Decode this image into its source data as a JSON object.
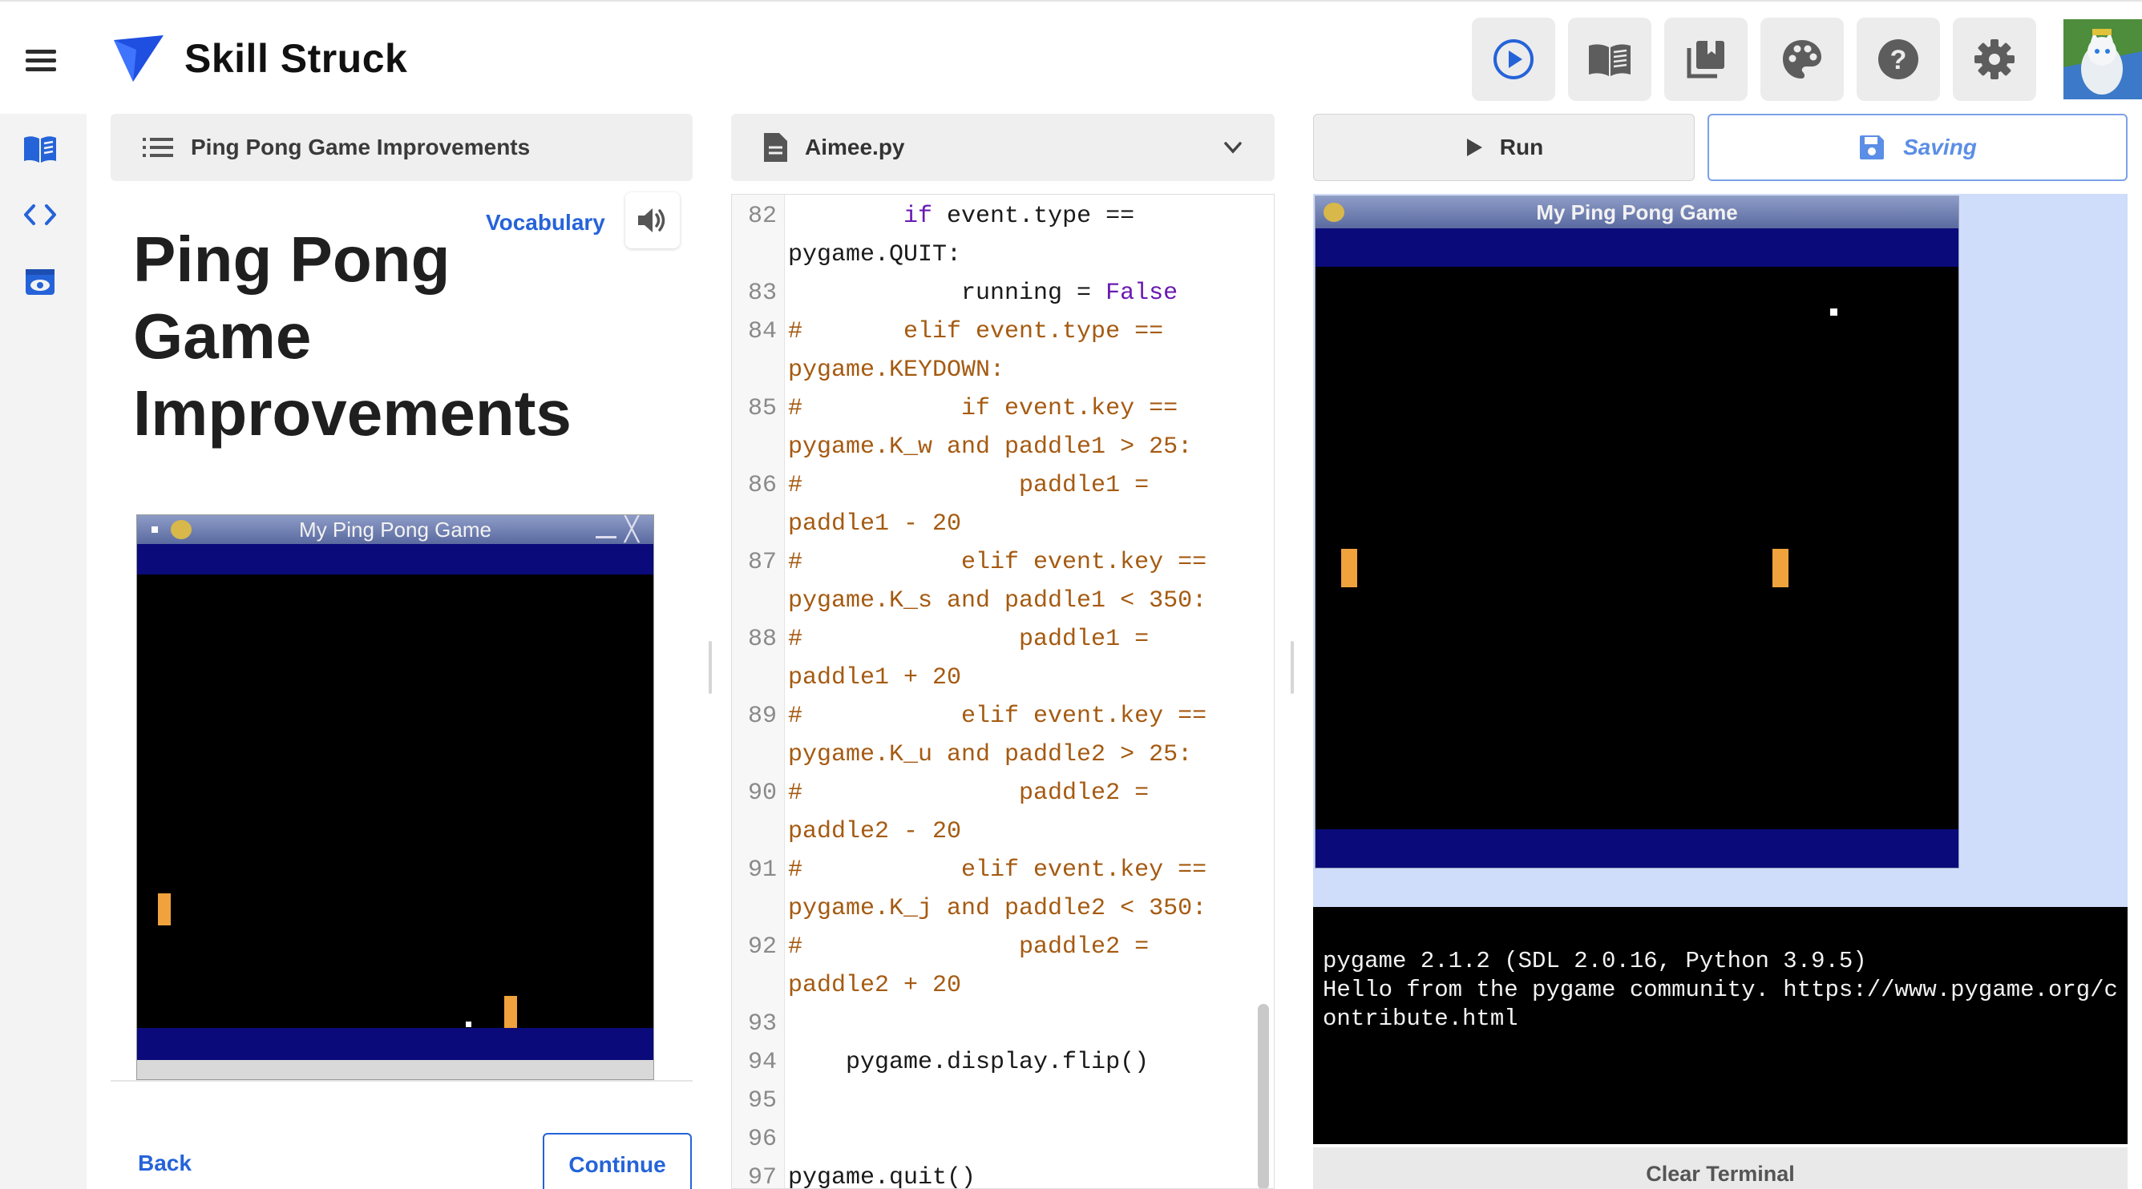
{
  "app": {
    "brand": "Skill Struck"
  },
  "toolbar": {
    "icons": [
      "run-preview-icon",
      "book-icon",
      "library-icon",
      "palette-icon",
      "help-icon",
      "settings-icon"
    ]
  },
  "left_rail": {
    "icons": [
      "lesson-book-icon",
      "code-brackets-icon",
      "preview-eye-icon"
    ]
  },
  "lesson": {
    "header_title": "Ping Pong Game Improvements",
    "title": "Ping Pong Game Improvements",
    "vocabulary_label": "Vocabulary",
    "game_window_title": "My Ping Pong Game",
    "back_label": "Back",
    "continue_label": "Continue"
  },
  "editor": {
    "file_name": "Aimee.py",
    "lines": [
      {
        "n": "82",
        "text": "        if event.type ==",
        "type": "code"
      },
      {
        "n": "",
        "text": "pygame.QUIT:",
        "type": "code"
      },
      {
        "n": "83",
        "text": "            running = False",
        "type": "code"
      },
      {
        "n": "84",
        "text": "#       elif event.type ==",
        "type": "comment"
      },
      {
        "n": "",
        "text": "pygame.KEYDOWN:",
        "type": "comment"
      },
      {
        "n": "85",
        "text": "#           if event.key ==",
        "type": "comment"
      },
      {
        "n": "",
        "text": "pygame.K_w and paddle1 > 25:",
        "type": "comment"
      },
      {
        "n": "86",
        "text": "#               paddle1 =",
        "type": "comment"
      },
      {
        "n": "",
        "text": "paddle1 - 20",
        "type": "comment"
      },
      {
        "n": "87",
        "text": "#           elif event.key ==",
        "type": "comment"
      },
      {
        "n": "",
        "text": "pygame.K_s and paddle1 < 350:",
        "type": "comment"
      },
      {
        "n": "88",
        "text": "#               paddle1 =",
        "type": "comment"
      },
      {
        "n": "",
        "text": "paddle1 + 20",
        "type": "comment"
      },
      {
        "n": "89",
        "text": "#           elif event.key ==",
        "type": "comment"
      },
      {
        "n": "",
        "text": "pygame.K_u and paddle2 > 25:",
        "type": "comment"
      },
      {
        "n": "90",
        "text": "#               paddle2 =",
        "type": "comment"
      },
      {
        "n": "",
        "text": "paddle2 - 20",
        "type": "comment"
      },
      {
        "n": "91",
        "text": "#           elif event.key ==",
        "type": "comment"
      },
      {
        "n": "",
        "text": "pygame.K_j and paddle2 < 350:",
        "type": "comment"
      },
      {
        "n": "92",
        "text": "#               paddle2 =",
        "type": "comment"
      },
      {
        "n": "",
        "text": "paddle2 + 20",
        "type": "comment"
      },
      {
        "n": "93",
        "text": "",
        "type": "code"
      },
      {
        "n": "94",
        "text": "    pygame.display.flip()",
        "type": "code"
      },
      {
        "n": "95",
        "text": "",
        "type": "code"
      },
      {
        "n": "96",
        "text": "",
        "type": "code"
      },
      {
        "n": "97",
        "text": "pygame.quit()",
        "type": "code"
      }
    ]
  },
  "runner": {
    "run_label": "Run",
    "saving_label": "Saving",
    "game_window_title": "My Ping Pong Game",
    "terminal_text": "pygame 2.1.2 (SDL 2.0.16, Python 3.9.5)\nHello from the pygame community. https://www.pygame.org/contribute.html",
    "clear_terminal_label": "Clear Terminal"
  },
  "colors": {
    "accent": "#2563d9",
    "game_band": "#0a0a7a",
    "paddle": "#f0a23c",
    "comment": "#a55a11",
    "keyword": "#6a1ab0"
  }
}
